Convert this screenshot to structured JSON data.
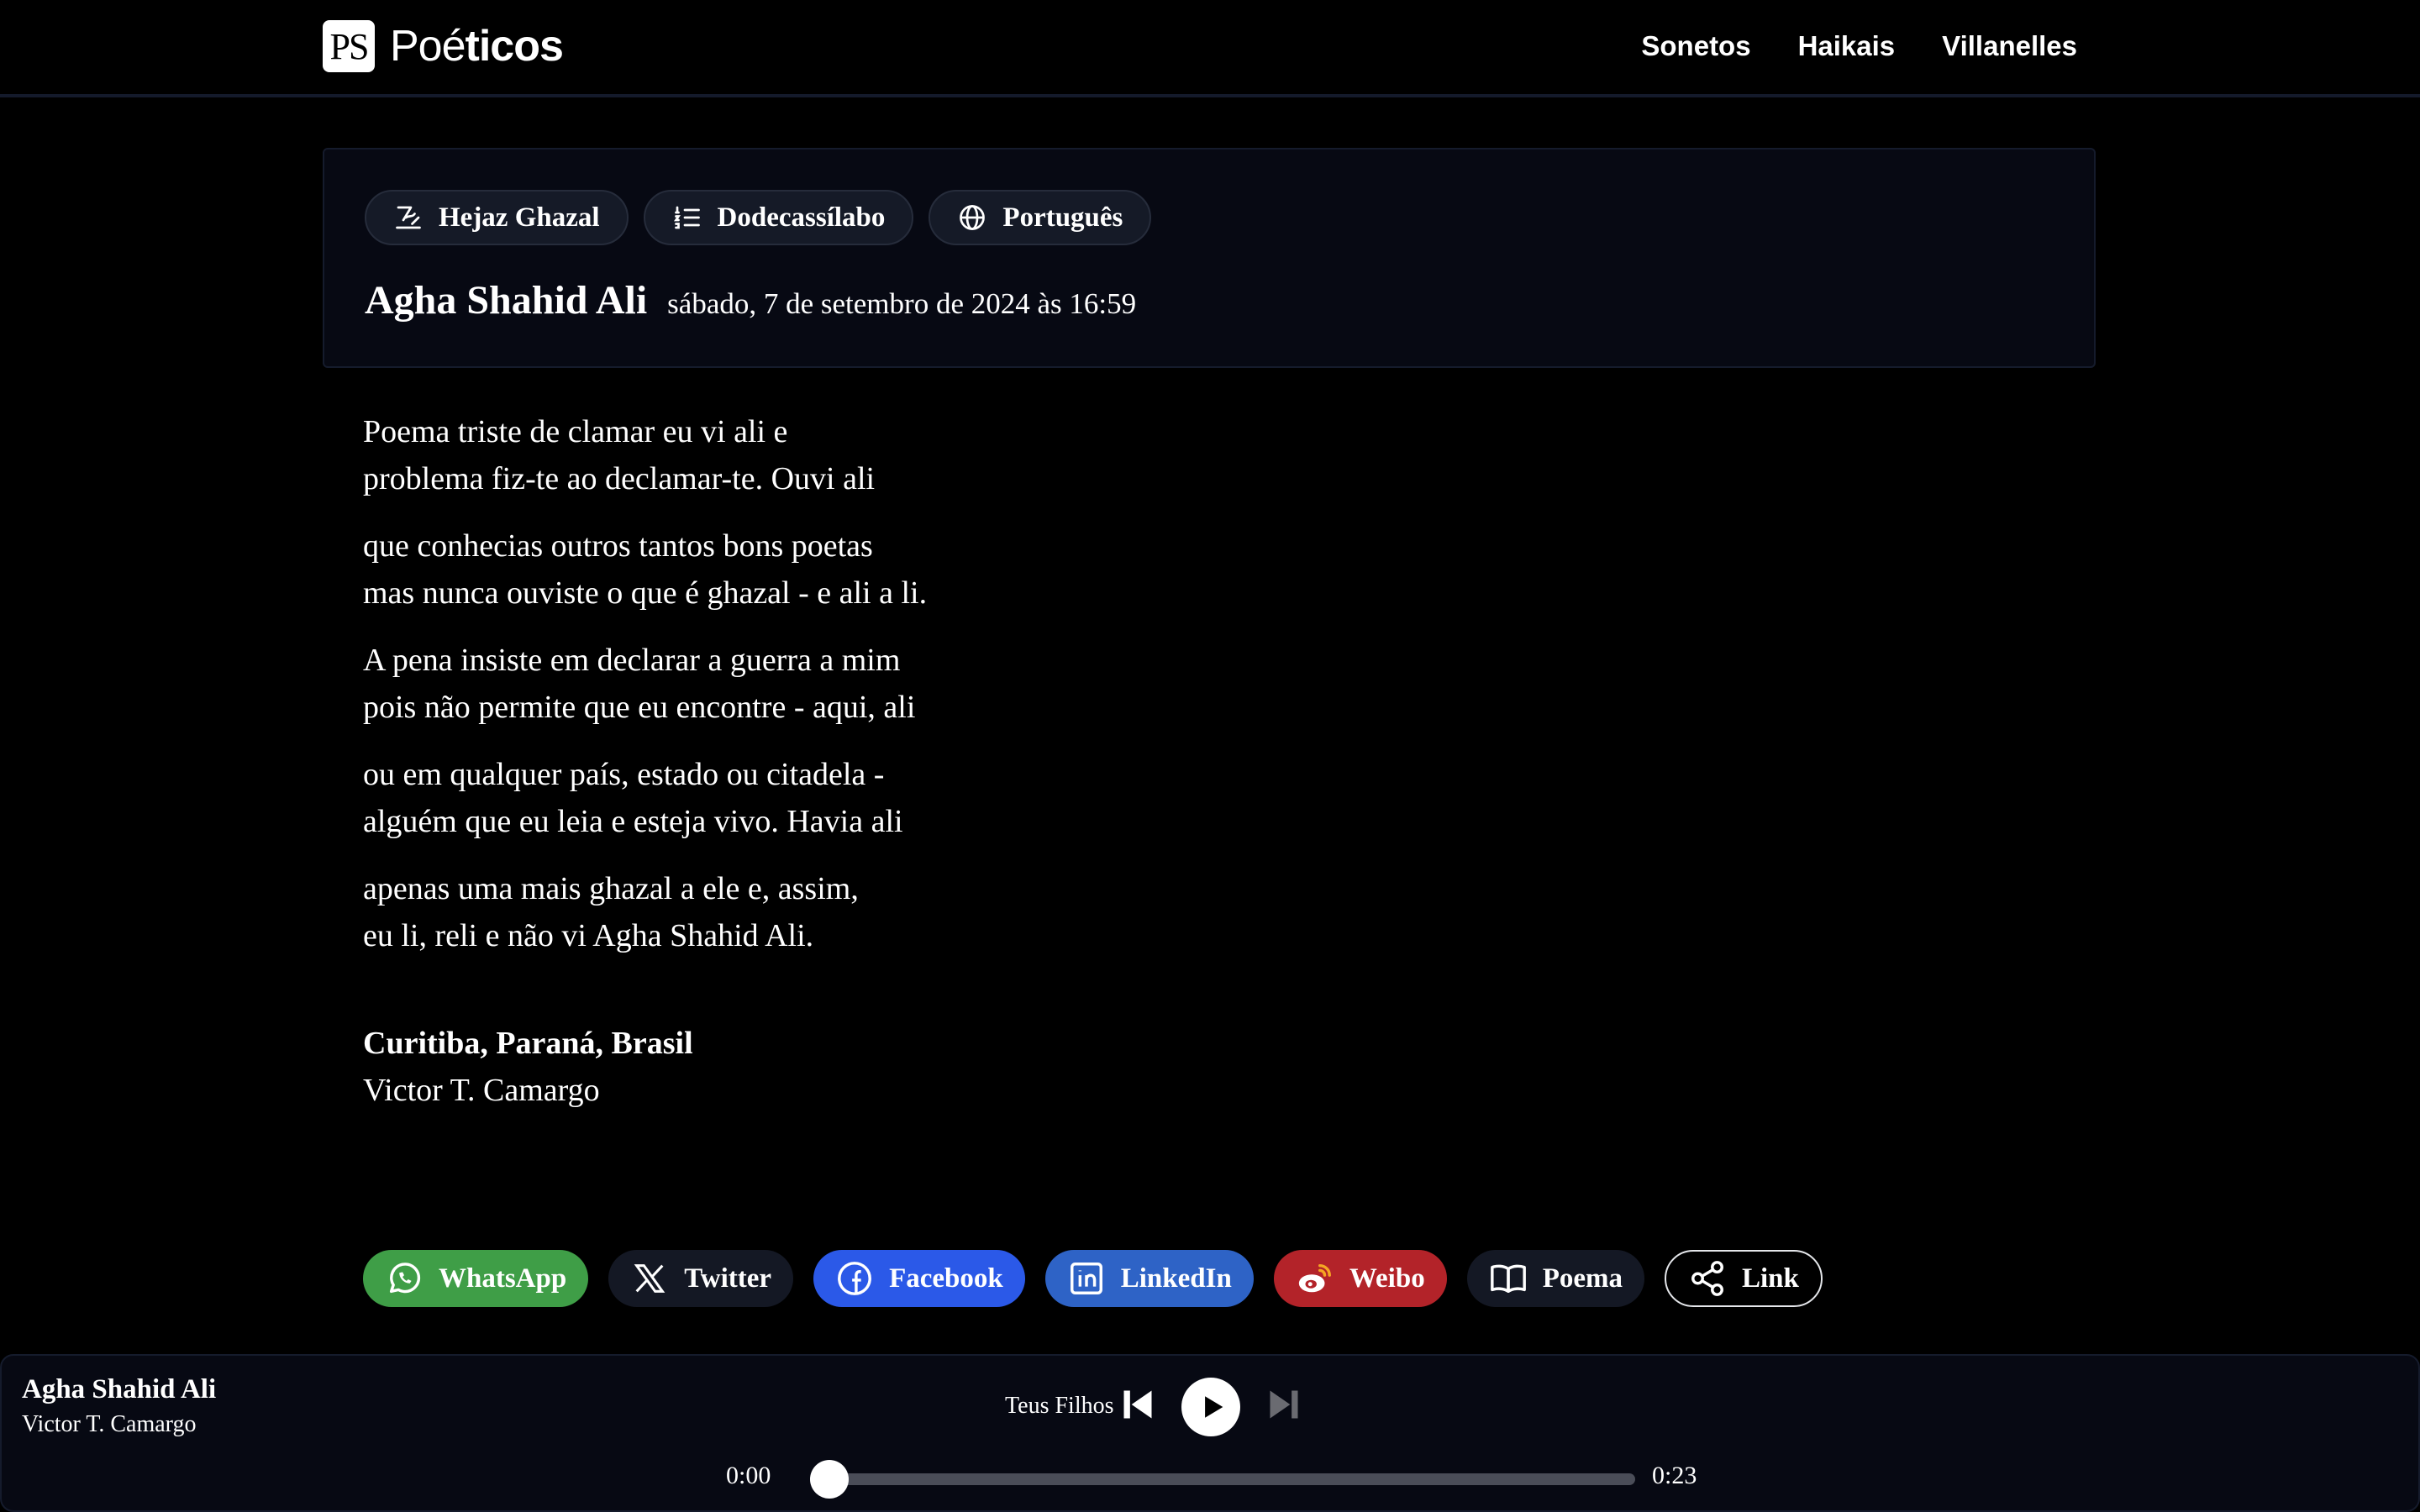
{
  "header": {
    "logo_badge": "PS",
    "logo_text_light": "Poé",
    "logo_text_bold": "ticos",
    "nav": [
      "Sonetos",
      "Haikais",
      "Villanelles"
    ]
  },
  "meta": {
    "tags": [
      {
        "label": "Hejaz Ghazal",
        "icon": "signature-icon"
      },
      {
        "label": "Dodecassílabo",
        "icon": "numbered-list-icon"
      },
      {
        "label": "Português",
        "icon": "globe-icon"
      }
    ],
    "author": "Agha Shahid Ali",
    "date": "sábado, 7 de setembro de 2024 às 16:59"
  },
  "poem": {
    "stanzas": [
      [
        "Poema triste de clamar eu vi ali e",
        "problema fiz-te ao declamar-te. Ouvi ali"
      ],
      [
        "que conhecias outros tantos bons poetas",
        "mas nunca ouviste o que é ghazal - e ali a li."
      ],
      [
        "A pena insiste em declarar a guerra a mim",
        "pois não permite que eu encontre - aqui, ali"
      ],
      [
        "ou em qualquer país, estado ou citadela -",
        "alguém que eu leia e esteja vivo. Havia ali"
      ],
      [
        "apenas uma mais ghazal a ele e, assim,",
        "eu li, reli e não vi Agha Shahid Ali."
      ]
    ],
    "location": "Curitiba, Paraná, Brasil",
    "poet": "Victor T. Camargo"
  },
  "share": {
    "whatsapp": "WhatsApp",
    "twitter": "Twitter",
    "facebook": "Facebook",
    "linkedin": "LinkedIn",
    "weibo": "Weibo",
    "poema": "Poema",
    "link": "Link"
  },
  "player": {
    "title": "Agha Shahid Ali",
    "artist": "Victor T. Camargo",
    "track_label": "Teus Filhos",
    "time_current": "0:00",
    "time_total": "0:23",
    "progress": 0
  }
}
